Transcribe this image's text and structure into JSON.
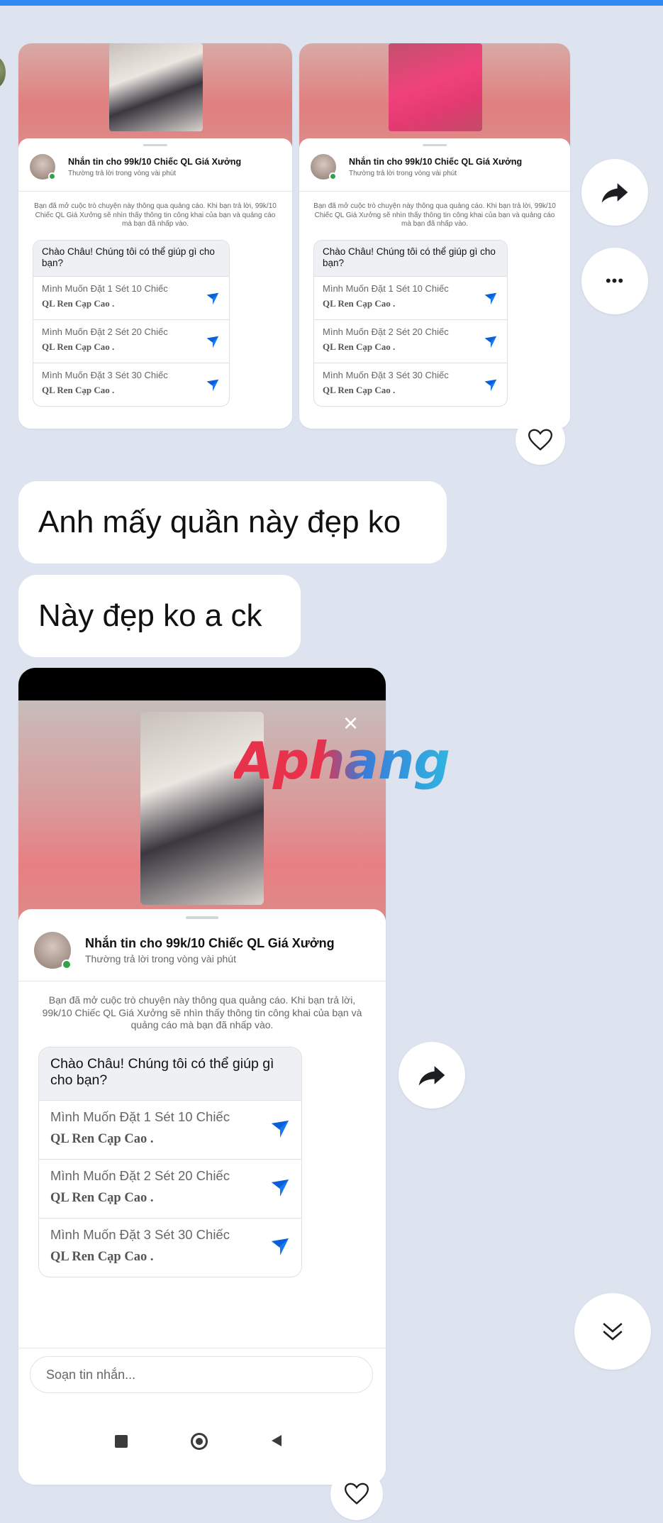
{
  "colors": {
    "accent": "#2f8af5",
    "background": "#dde3ef",
    "messenger_blue": "#1877f2"
  },
  "ad_card": {
    "page_name": "Nhắn tin cho 99k/10 Chiếc QL Giá Xưởng",
    "reply_time": "Thường trả lời trong vòng vài phút",
    "notice": "Bạn đã mở cuộc trò chuyện này thông qua quảng cáo. Khi bạn trả lời, 99k/10 Chiếc QL Giá Xưởng sẽ nhìn thấy thông tin công khai của bạn và quảng cáo mà bạn đã nhấp vào.",
    "greeting": "Chào Châu! Chúng tôi có thể giúp gì cho bạn?",
    "options": [
      {
        "line1": "Mình Muốn Đặt 1 Sét 10 Chiếc",
        "line2": "QL Ren Cạp Cao ."
      },
      {
        "line1": "Mình Muốn Đặt 2 Sét 20 Chiếc",
        "line2": "QL Ren Cạp Cao ."
      },
      {
        "line1": "Mình Muốn Đặt 3 Sét 30 Chiếc",
        "line2": "QL Ren Cạp Cao ."
      }
    ],
    "option_icon": "messenger-send-icon",
    "composer_placeholder": "Soạn tin nhắn..."
  },
  "messages": [
    {
      "text": "Anh mấy quần này đẹp ko"
    },
    {
      "text": "Này đẹp ko a ck"
    }
  ],
  "watermark": "Aphang",
  "close_glyph": "×",
  "more_glyph": "•••",
  "icons": {
    "share": "share-arrow-icon",
    "more": "more-dots-icon",
    "heart": "heart-outline-icon",
    "scroll_down": "double-chevron-down-icon",
    "close": "close-icon",
    "nav_square": "stop-square-icon",
    "nav_circle": "home-circle-icon",
    "nav_back": "back-triangle-icon"
  }
}
